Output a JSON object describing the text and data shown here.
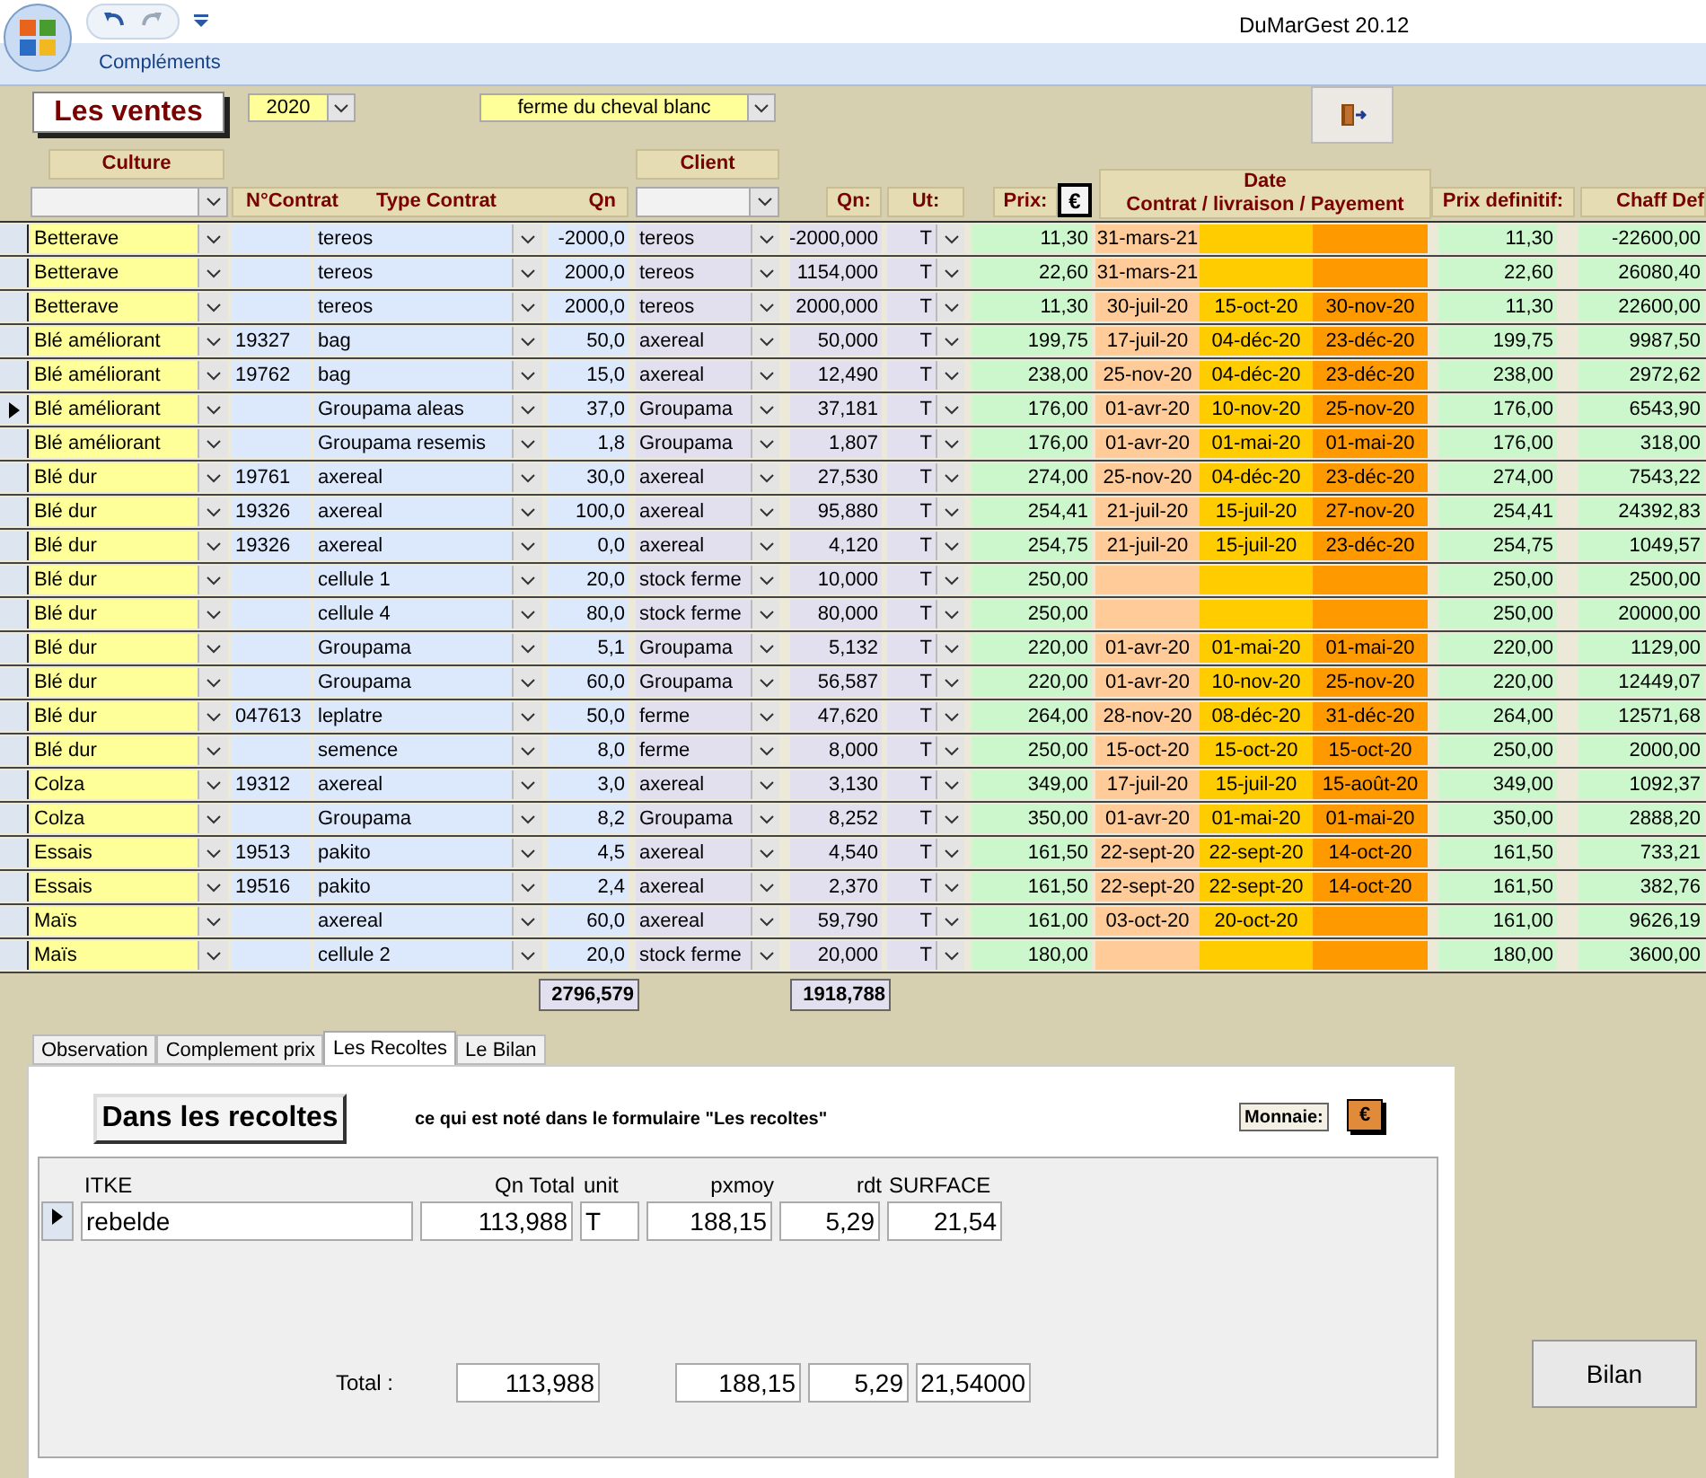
{
  "window": {
    "title": "DuMarGest 20.12"
  },
  "ribbon": {
    "tabs": [
      "Compléments"
    ]
  },
  "form": {
    "title": "Les ventes",
    "year": "2020",
    "farm": "ferme du cheval blanc"
  },
  "headers": {
    "culture": "Culture",
    "client": "Client",
    "contrat": "N°Contrat",
    "type": "Type Contrat",
    "qn": "Qn",
    "qn_client": "Qn:",
    "ut": "Ut:",
    "prix": "Prix:",
    "currency": "€",
    "date": "Date",
    "date_parts": "Contrat / livraison / Payement",
    "prix_def": "Prix definitif:",
    "chaff": "Chaff Def"
  },
  "rows": [
    {
      "selected": false,
      "culture": "Betterave",
      "contrat": "",
      "type": "tereos",
      "qn": "-2000,0",
      "client": "tereos",
      "qn_client": "-2000,000",
      "ut": "T",
      "prix": "11,30",
      "date_contrat": "31-mars-21",
      "date_livraison": "",
      "date_payement": "",
      "prix_def": "11,30",
      "chaff": "-22600,00"
    },
    {
      "selected": false,
      "culture": "Betterave",
      "contrat": "",
      "type": "tereos",
      "qn": "2000,0",
      "client": "tereos",
      "qn_client": "1154,000",
      "ut": "T",
      "prix": "22,60",
      "date_contrat": "31-mars-21",
      "date_livraison": "",
      "date_payement": "",
      "prix_def": "22,60",
      "chaff": "26080,40"
    },
    {
      "selected": false,
      "culture": "Betterave",
      "contrat": "",
      "type": "tereos",
      "qn": "2000,0",
      "client": "tereos",
      "qn_client": "2000,000",
      "ut": "T",
      "prix": "11,30",
      "date_contrat": "30-juil-20",
      "date_livraison": "15-oct-20",
      "date_payement": "30-nov-20",
      "prix_def": "11,30",
      "chaff": "22600,00"
    },
    {
      "selected": false,
      "culture": "Blé améliorant",
      "contrat": "19327",
      "type": "bag",
      "qn": "50,0",
      "client": "axereal",
      "qn_client": "50,000",
      "ut": "T",
      "prix": "199,75",
      "date_contrat": "17-juil-20",
      "date_livraison": "04-déc-20",
      "date_payement": "23-déc-20",
      "prix_def": "199,75",
      "chaff": "9987,50"
    },
    {
      "selected": false,
      "culture": "Blé améliorant",
      "contrat": "19762",
      "type": "bag",
      "qn": "15,0",
      "client": "axereal",
      "qn_client": "12,490",
      "ut": "T",
      "prix": "238,00",
      "date_contrat": "25-nov-20",
      "date_livraison": "04-déc-20",
      "date_payement": "23-déc-20",
      "prix_def": "238,00",
      "chaff": "2972,62"
    },
    {
      "selected": true,
      "culture": "Blé améliorant",
      "contrat": "",
      "type": "Groupama aleas",
      "qn": "37,0",
      "client": "Groupama",
      "qn_client": "37,181",
      "ut": "T",
      "prix": "176,00",
      "date_contrat": "01-avr-20",
      "date_livraison": "10-nov-20",
      "date_payement": "25-nov-20",
      "prix_def": "176,00",
      "chaff": "6543,90"
    },
    {
      "selected": false,
      "culture": "Blé améliorant",
      "contrat": "",
      "type": "Groupama resemis",
      "qn": "1,8",
      "client": "Groupama",
      "qn_client": "1,807",
      "ut": "T",
      "prix": "176,00",
      "date_contrat": "01-avr-20",
      "date_livraison": "01-mai-20",
      "date_payement": "01-mai-20",
      "prix_def": "176,00",
      "chaff": "318,00"
    },
    {
      "selected": false,
      "culture": "Blé dur",
      "contrat": "19761",
      "type": "axereal",
      "qn": "30,0",
      "client": "axereal",
      "qn_client": "27,530",
      "ut": "T",
      "prix": "274,00",
      "date_contrat": "25-nov-20",
      "date_livraison": "04-déc-20",
      "date_payement": "23-déc-20",
      "prix_def": "274,00",
      "chaff": "7543,22"
    },
    {
      "selected": false,
      "culture": "Blé dur",
      "contrat": "19326",
      "type": "axereal",
      "qn": "100,0",
      "client": "axereal",
      "qn_client": "95,880",
      "ut": "T",
      "prix": "254,41",
      "date_contrat": "21-juil-20",
      "date_livraison": "15-juil-20",
      "date_payement": "27-nov-20",
      "prix_def": "254,41",
      "chaff": "24392,83"
    },
    {
      "selected": false,
      "culture": "Blé dur",
      "contrat": "19326",
      "type": "axereal",
      "qn": "0,0",
      "client": "axereal",
      "qn_client": "4,120",
      "ut": "T",
      "prix": "254,75",
      "date_contrat": "21-juil-20",
      "date_livraison": "15-juil-20",
      "date_payement": "23-déc-20",
      "prix_def": "254,75",
      "chaff": "1049,57"
    },
    {
      "selected": false,
      "culture": "Blé dur",
      "contrat": "",
      "type": "cellule 1",
      "qn": "20,0",
      "client": "stock ferme",
      "qn_client": "10,000",
      "ut": "T",
      "prix": "250,00",
      "date_contrat": "",
      "date_livraison": "",
      "date_payement": "",
      "prix_def": "250,00",
      "chaff": "2500,00"
    },
    {
      "selected": false,
      "culture": "Blé dur",
      "contrat": "",
      "type": "cellule 4",
      "qn": "80,0",
      "client": "stock ferme",
      "qn_client": "80,000",
      "ut": "T",
      "prix": "250,00",
      "date_contrat": "",
      "date_livraison": "",
      "date_payement": "",
      "prix_def": "250,00",
      "chaff": "20000,00"
    },
    {
      "selected": false,
      "culture": "Blé dur",
      "contrat": "",
      "type": "Groupama",
      "qn": "5,1",
      "client": "Groupama",
      "qn_client": "5,132",
      "ut": "T",
      "prix": "220,00",
      "date_contrat": "01-avr-20",
      "date_livraison": "01-mai-20",
      "date_payement": "01-mai-20",
      "prix_def": "220,00",
      "chaff": "1129,00"
    },
    {
      "selected": false,
      "culture": "Blé dur",
      "contrat": "",
      "type": "Groupama",
      "qn": "60,0",
      "client": "Groupama",
      "qn_client": "56,587",
      "ut": "T",
      "prix": "220,00",
      "date_contrat": "01-avr-20",
      "date_livraison": "10-nov-20",
      "date_payement": "25-nov-20",
      "prix_def": "220,00",
      "chaff": "12449,07"
    },
    {
      "selected": false,
      "culture": "Blé dur",
      "contrat": "047613",
      "type": "leplatre",
      "qn": "50,0",
      "client": "ferme",
      "qn_client": "47,620",
      "ut": "T",
      "prix": "264,00",
      "date_contrat": "28-nov-20",
      "date_livraison": "08-déc-20",
      "date_payement": "31-déc-20",
      "prix_def": "264,00",
      "chaff": "12571,68"
    },
    {
      "selected": false,
      "culture": "Blé dur",
      "contrat": "",
      "type": "semence",
      "qn": "8,0",
      "client": "ferme",
      "qn_client": "8,000",
      "ut": "T",
      "prix": "250,00",
      "date_contrat": "15-oct-20",
      "date_livraison": "15-oct-20",
      "date_payement": "15-oct-20",
      "prix_def": "250,00",
      "chaff": "2000,00"
    },
    {
      "selected": false,
      "culture": "Colza",
      "contrat": "19312",
      "type": "axereal",
      "qn": "3,0",
      "client": "axereal",
      "qn_client": "3,130",
      "ut": "T",
      "prix": "349,00",
      "date_contrat": "17-juil-20",
      "date_livraison": "15-juil-20",
      "date_payement": "15-août-20",
      "prix_def": "349,00",
      "chaff": "1092,37"
    },
    {
      "selected": false,
      "culture": "Colza",
      "contrat": "",
      "type": "Groupama",
      "qn": "8,2",
      "client": "Groupama",
      "qn_client": "8,252",
      "ut": "T",
      "prix": "350,00",
      "date_contrat": "01-avr-20",
      "date_livraison": "01-mai-20",
      "date_payement": "01-mai-20",
      "prix_def": "350,00",
      "chaff": "2888,20"
    },
    {
      "selected": false,
      "culture": "Essais",
      "contrat": "19513",
      "type": "pakito",
      "qn": "4,5",
      "client": "axereal",
      "qn_client": "4,540",
      "ut": "T",
      "prix": "161,50",
      "date_contrat": "22-sept-20",
      "date_livraison": "22-sept-20",
      "date_payement": "14-oct-20",
      "prix_def": "161,50",
      "chaff": "733,21"
    },
    {
      "selected": false,
      "culture": "Essais",
      "contrat": "19516",
      "type": "pakito",
      "qn": "2,4",
      "client": "axereal",
      "qn_client": "2,370",
      "ut": "T",
      "prix": "161,50",
      "date_contrat": "22-sept-20",
      "date_livraison": "22-sept-20",
      "date_payement": "14-oct-20",
      "prix_def": "161,50",
      "chaff": "382,76"
    },
    {
      "selected": false,
      "culture": "Maïs",
      "contrat": "",
      "type": "axereal",
      "qn": "60,0",
      "client": "axereal",
      "qn_client": "59,790",
      "ut": "T",
      "prix": "161,00",
      "date_contrat": "03-oct-20",
      "date_livraison": "20-oct-20",
      "date_payement": "",
      "prix_def": "161,00",
      "chaff": "9626,19"
    },
    {
      "selected": false,
      "culture": "Maïs",
      "contrat": "",
      "type": "cellule 2",
      "qn": "20,0",
      "client": "stock ferme",
      "qn_client": "20,000",
      "ut": "T",
      "prix": "180,00",
      "date_contrat": "",
      "date_livraison": "",
      "date_payement": "",
      "prix_def": "180,00",
      "chaff": "3600,00"
    }
  ],
  "totals": {
    "qn": "2796,579",
    "qn_client": "1918,788"
  },
  "tabs": [
    {
      "label": "Observation",
      "selected": false
    },
    {
      "label": "Complement prix",
      "selected": false
    },
    {
      "label": "Les Recoltes",
      "selected": true
    },
    {
      "label": "Le Bilan",
      "selected": false
    }
  ],
  "recoltes": {
    "button": "Dans les recoltes",
    "note": "ce qui est noté dans le formulaire \"Les recoltes\"",
    "currency_label": "Monnaie:",
    "currency": "€",
    "columns": [
      "ITKE",
      "Qn Total",
      "unit",
      "pxmoy",
      "rdt",
      "SURFACE"
    ],
    "rows": [
      {
        "selected": true,
        "itke": "rebelde",
        "qn_total": "113,988",
        "unit": "T",
        "pxmoy": "188,15",
        "rdt": "5,29",
        "surface": "21,54"
      }
    ],
    "total_label": "Total :",
    "total": {
      "qn_total": "113,988",
      "pxmoy": "188,15",
      "rdt": "5,29",
      "surface": "21,54000"
    }
  },
  "bilan_button": "Bilan"
}
